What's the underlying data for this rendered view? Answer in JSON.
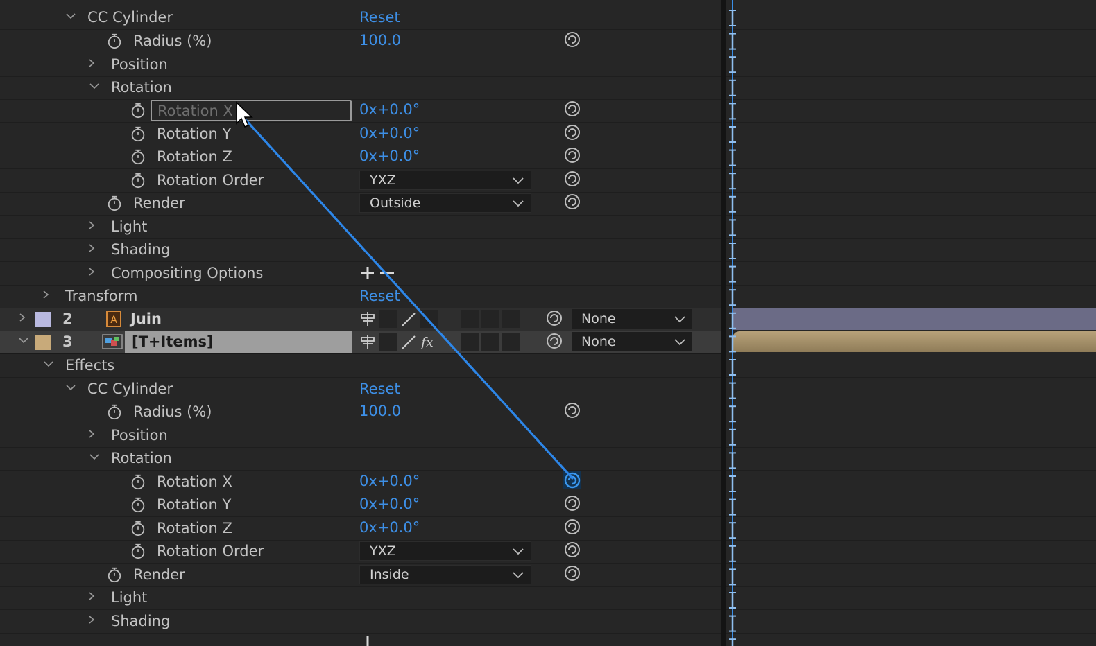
{
  "top": {
    "effect_name": "CC Cylinder",
    "reset_label": "Reset",
    "radius_label": "Radius (%)",
    "radius_value": "100.0",
    "position_label": "Position",
    "rotation_label": "Rotation",
    "rotation_x_label": "Rotation X",
    "rotation_x_value": "0x+0.0°",
    "rotation_y_label": "Rotation Y",
    "rotation_y_value": "0x+0.0°",
    "rotation_z_label": "Rotation Z",
    "rotation_z_value": "0x+0.0°",
    "rotation_order_label": "Rotation Order",
    "rotation_order_value": "YXZ",
    "render_label": "Render",
    "render_value": "Outside",
    "light_label": "Light",
    "shading_label": "Shading",
    "compositing_label": "Compositing Options"
  },
  "transform": {
    "label": "Transform",
    "reset_label": "Reset"
  },
  "layers": [
    {
      "number": "2",
      "name": "Juin",
      "parent": "None",
      "color": "#b9b9e0"
    },
    {
      "number": "3",
      "name": "[T+Items]",
      "parent": "None",
      "color": "#c8aa7a"
    }
  ],
  "bottom": {
    "effects_label": "Effects",
    "effect_name": "CC Cylinder",
    "reset_label": "Reset",
    "radius_label": "Radius (%)",
    "radius_value": "100.0",
    "position_label": "Position",
    "rotation_label": "Rotation",
    "rotation_x_label": "Rotation X",
    "rotation_x_value": "0x+0.0°",
    "rotation_y_label": "Rotation Y",
    "rotation_y_value": "0x+0.0°",
    "rotation_z_label": "Rotation Z",
    "rotation_z_value": "0x+0.0°",
    "rotation_order_label": "Rotation Order",
    "rotation_order_value": "YXZ",
    "render_label": "Render",
    "render_value": "Inside",
    "light_label": "Light",
    "shading_label": "Shading"
  },
  "colors": {
    "value_blue": "#3d8fe6",
    "pickwhip": "#2d86e8",
    "layer2_bar": "#6b6b86",
    "layer3_bar": "#a3916c"
  },
  "icons": [
    "stopwatch-icon",
    "pickwhip-icon",
    "chevron-right-icon",
    "chevron-down-icon",
    "mouse-cursor-icon",
    "playhead-icon"
  ]
}
